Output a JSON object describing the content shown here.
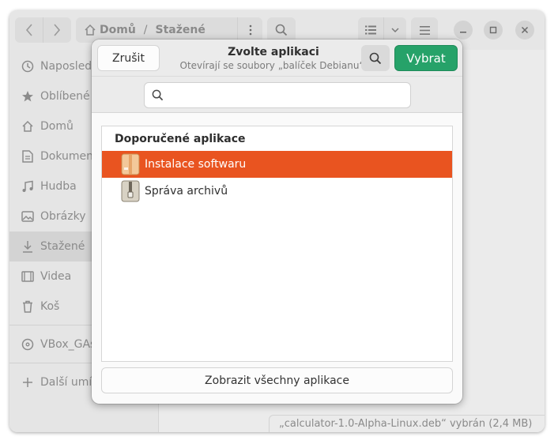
{
  "window": {
    "path": {
      "home": "Domů",
      "separator": "/",
      "current": "Stažené"
    },
    "sidebar": [
      {
        "label": "Naposled",
        "icon": "clock-icon"
      },
      {
        "label": "Oblíbené",
        "icon": "star-icon"
      },
      {
        "label": "Domů",
        "icon": "home-icon"
      },
      {
        "label": "Dokumen",
        "icon": "document-icon"
      },
      {
        "label": "Hudba",
        "icon": "music-icon"
      },
      {
        "label": "Obrázky",
        "icon": "image-icon"
      },
      {
        "label": "Stažené",
        "icon": "download-icon",
        "active": true
      },
      {
        "label": "Videa",
        "icon": "video-icon"
      },
      {
        "label": "Koš",
        "icon": "trash-icon"
      },
      {
        "label": "VBox_GAs",
        "icon": "disc-icon"
      },
      {
        "label": "Další umís",
        "icon": "plus-icon"
      }
    ],
    "status": "„calculator-1.0-Alpha-Linux.deb“ vybrán  (2,4 MB)"
  },
  "dialog": {
    "cancel_label": "Zrušit",
    "title": "Zvolte aplikaci",
    "subtitle": "Otevírají se soubory „balíček Debianu“.",
    "select_label": "Vybrat",
    "search_placeholder": "",
    "list_heading": "Doporučené aplikace",
    "apps": [
      {
        "label": "Instalace softwaru",
        "selected": true,
        "icon": "package-icon"
      },
      {
        "label": "Správa archivů",
        "selected": false,
        "icon": "archive-icon"
      }
    ],
    "show_all_label": "Zobrazit všechny aplikace"
  },
  "colors": {
    "accent": "#e95420",
    "select_button": "#26a269"
  }
}
